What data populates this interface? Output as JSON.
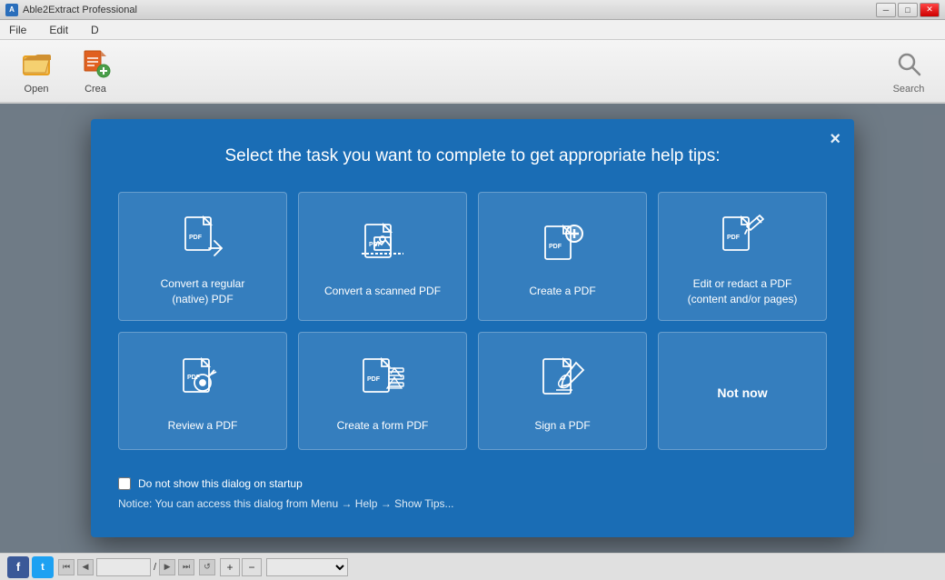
{
  "titleBar": {
    "title": "Able2Extract Professional",
    "minBtn": "─",
    "maxBtn": "□",
    "closeBtn": "✕"
  },
  "menuBar": {
    "items": [
      "File",
      "Edit",
      "D"
    ]
  },
  "toolbar": {
    "buttons": [
      {
        "label": "Open",
        "icon": "open-folder-icon"
      },
      {
        "label": "Crea",
        "icon": "create-icon"
      }
    ],
    "searchLabel": "Search"
  },
  "dialog": {
    "title": "Select the task you want to complete to get appropriate help tips:",
    "closeLabel": "×",
    "tasks": [
      {
        "id": "convert-native",
        "label": "Convert a regular\n(native) PDF",
        "icon": "pdf-convert-icon"
      },
      {
        "id": "convert-scanned",
        "label": "Convert a scanned PDF",
        "icon": "pdf-scan-icon"
      },
      {
        "id": "create-pdf",
        "label": "Create a PDF",
        "icon": "pdf-create-icon"
      },
      {
        "id": "edit-redact",
        "label": "Edit or redact a PDF\n(content and/or pages)",
        "icon": "pdf-edit-icon"
      },
      {
        "id": "review-pdf",
        "label": "Review a PDF",
        "icon": "pdf-review-icon"
      },
      {
        "id": "create-form",
        "label": "Create a form PDF",
        "icon": "pdf-form-icon"
      },
      {
        "id": "sign-pdf",
        "label": "Sign a PDF",
        "icon": "pdf-sign-icon"
      },
      {
        "id": "not-now",
        "label": "Not now",
        "icon": null
      }
    ],
    "checkboxLabel": "Do not show this dialog on startup",
    "noticeText": "Notice: You can access this dialog from Menu → Help → Show Tips..."
  },
  "statusBar": {
    "facebook": "f",
    "twitter": "t",
    "pageValue": "",
    "pageSeparator": "/",
    "zoomOptions": [
      ""
    ]
  }
}
